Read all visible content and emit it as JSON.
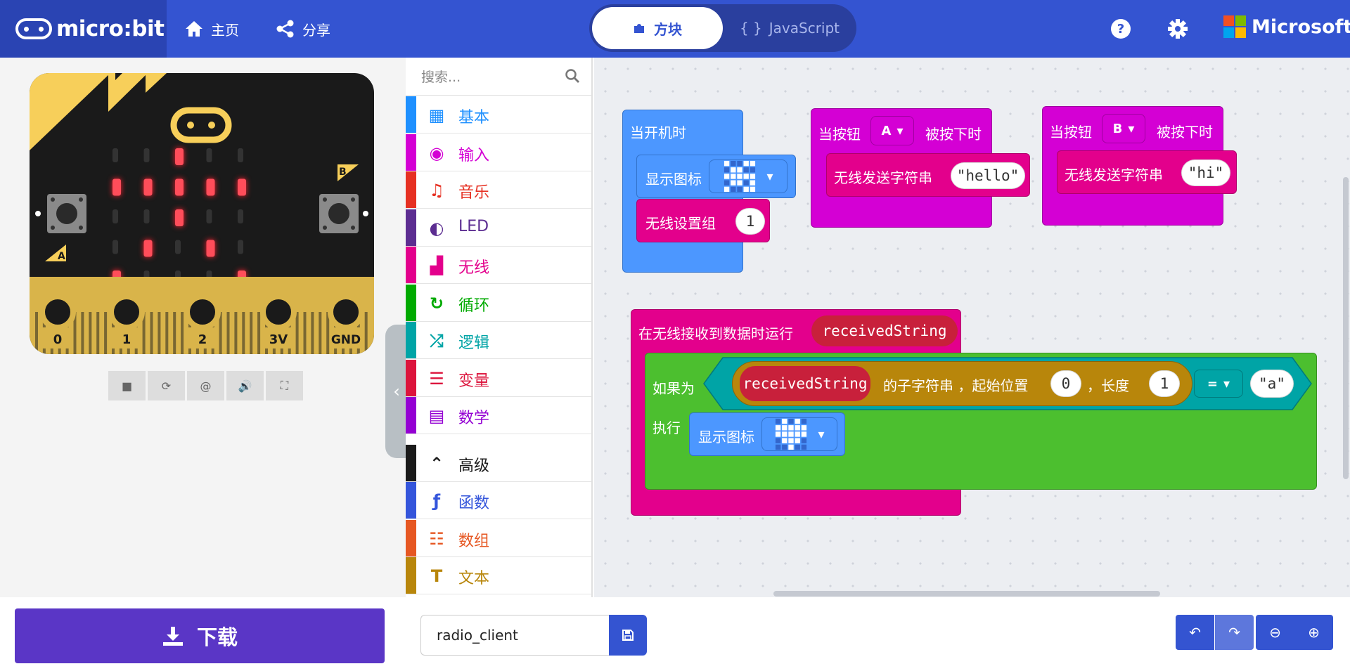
{
  "header": {
    "logo_text": "micro:bit",
    "home_label": "主页",
    "share_label": "分享",
    "tab_blocks": "方块",
    "tab_js": "JavaScript",
    "microsoft_label": "Microsoft"
  },
  "simulator": {
    "pins": [
      "0",
      "1",
      "2",
      "3V",
      "GND"
    ],
    "button_a": "A",
    "button_b": "B"
  },
  "toolbox": {
    "search_placeholder": "搜索...",
    "categories": [
      {
        "label": "基本",
        "color": "#1e90ff"
      },
      {
        "label": "输入",
        "color": "#d400d4"
      },
      {
        "label": "音乐",
        "color": "#e63022"
      },
      {
        "label": "LED",
        "color": "#5c2d91"
      },
      {
        "label": "无线",
        "color": "#e3008c"
      },
      {
        "label": "循环",
        "color": "#00aa00"
      },
      {
        "label": "逻辑",
        "color": "#00a4a6"
      },
      {
        "label": "变量",
        "color": "#dc143c"
      },
      {
        "label": "数学",
        "color": "#9400d3"
      },
      {
        "label": "高级",
        "color": "#1a1a1a"
      },
      {
        "label": "函数",
        "color": "#3455db"
      },
      {
        "label": "数组",
        "color": "#e65722"
      },
      {
        "label": "文本",
        "color": "#b8860b"
      }
    ]
  },
  "workspace": {
    "on_start": {
      "title": "当开机时",
      "show_icon": "显示图标",
      "radio_set_group": "无线设置组",
      "group_value": "1"
    },
    "button_a": {
      "pre": "当按钮",
      "button": "A",
      "post": "被按下时",
      "send": "无线发送字符串",
      "value": "hello"
    },
    "button_b": {
      "pre": "当按钮",
      "button": "B",
      "post": "被按下时",
      "send": "无线发送字符串",
      "value": "hi"
    },
    "on_receive": {
      "title": "在无线接收到数据时运行",
      "var": "receivedString",
      "if_label": "如果为",
      "then_label": "执行",
      "substr_label": "的子字符串 ，起始位置",
      "comma_length": "，长度",
      "start": "0",
      "length": "1",
      "op": "=",
      "compare": "a",
      "show_icon": "显示图标"
    }
  },
  "footer": {
    "download_label": "下载",
    "project_name": "radio_client"
  },
  "colors": {
    "header": "#3454d1",
    "basic": "#4c97ff",
    "radio": "#e3008c",
    "loops": "#4cbf2f",
    "logic": "#00a4a6",
    "variables": "#dc143c",
    "download": "#5a36c6"
  }
}
